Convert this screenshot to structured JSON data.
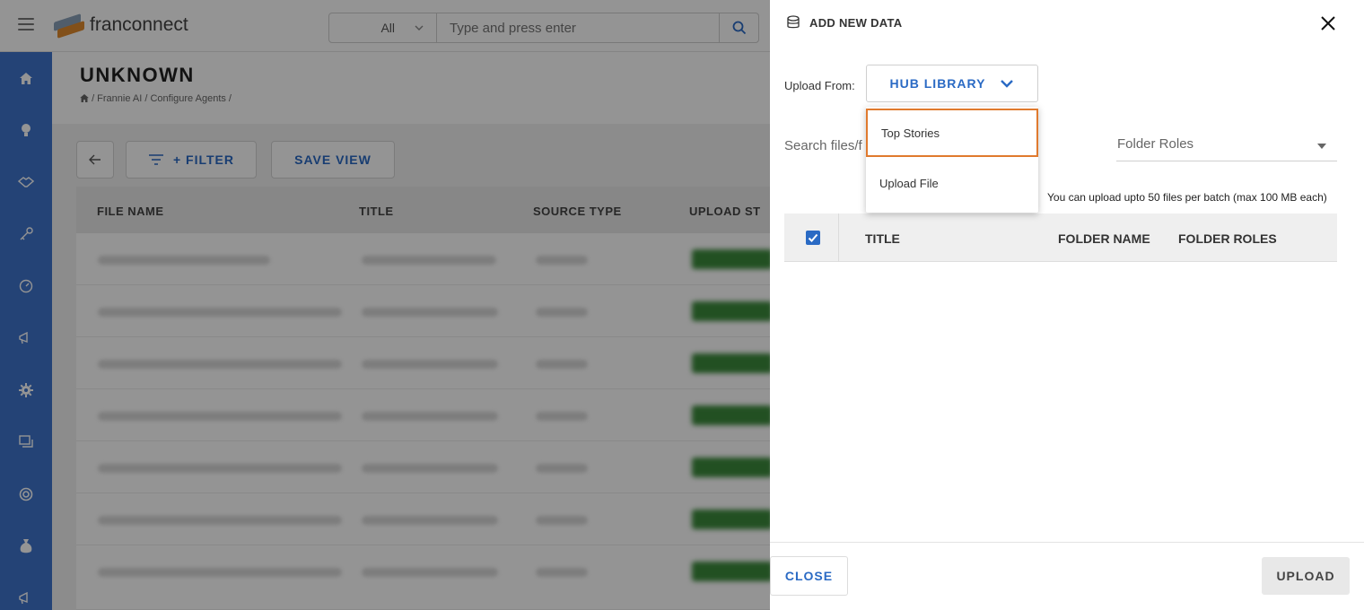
{
  "topbar": {
    "brand": "franconnect",
    "search_scope": "All",
    "search_placeholder": "Type and press enter"
  },
  "sidenav": {
    "icons": [
      "home-icon",
      "bulb-icon",
      "handshake-icon",
      "key-icon",
      "gauge-icon",
      "megaphone-icon",
      "gear-icon",
      "chat-icon",
      "lifebuoy-icon",
      "money-bag-icon",
      "megaphone-icon"
    ]
  },
  "page": {
    "title": "UNKNOWN",
    "breadcrumb": "/ Frannie AI / Configure Agents /",
    "filter_label": "+ FILTER",
    "save_view_label": "SAVE VIEW",
    "columns": [
      "FILE NAME",
      "TITLE",
      "SOURCE TYPE",
      "UPLOAD ST"
    ]
  },
  "drawer": {
    "title": "ADD NEW DATA",
    "upload_from_label": "Upload From:",
    "upload_from_value": "HUB LIBRARY",
    "dropdown_options": [
      "Top Stories",
      "Upload File"
    ],
    "search_placeholder": "Search files/f",
    "folder_roles_placeholder": "Folder Roles",
    "upload_note": "You can upload upto 50 files per batch (max 100 MB each)",
    "table_columns": [
      "TITLE",
      "FOLDER NAME",
      "FOLDER ROLES"
    ],
    "close_label": "CLOSE",
    "upload_label": "UPLOAD"
  },
  "colors": {
    "accent": "#2a6ac4",
    "sidenav": "#3f74cc",
    "highlight": "#e07a2e"
  }
}
